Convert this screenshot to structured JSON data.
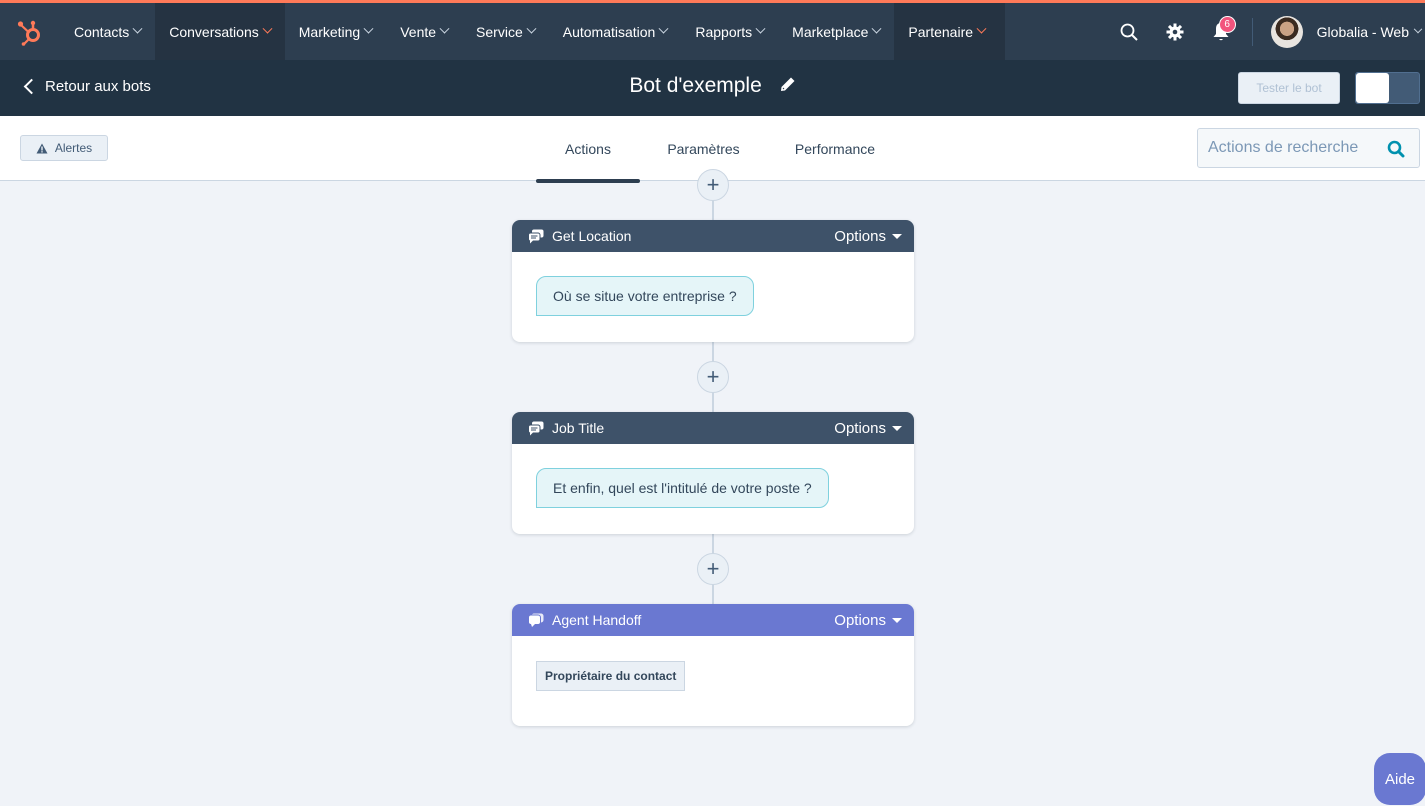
{
  "topnav": {
    "logo": "hubspot-sprocket-icon",
    "items": [
      {
        "label": "Contacts",
        "active": false
      },
      {
        "label": "Conversations",
        "active": true
      },
      {
        "label": "Marketing",
        "active": false
      },
      {
        "label": "Vente",
        "active": false
      },
      {
        "label": "Service",
        "active": false
      },
      {
        "label": "Automatisation",
        "active": false
      },
      {
        "label": "Rapports",
        "active": false
      },
      {
        "label": "Marketplace",
        "active": false
      },
      {
        "label": "Partenaire",
        "active": true
      }
    ],
    "notifications_count": "6",
    "account_name": "Globalia - Web",
    "icons": [
      "search-icon",
      "gear-icon",
      "bell-icon"
    ]
  },
  "subheader": {
    "back_label": "Retour aux bots",
    "title": "Bot d'exemple",
    "test_button": "Tester le bot",
    "toggle_on": false
  },
  "tabbar": {
    "alerts_label": "Alertes",
    "tabs": [
      {
        "label": "Actions",
        "active": true
      },
      {
        "label": "Paramètres",
        "active": false
      },
      {
        "label": "Performance",
        "active": false
      }
    ],
    "search_placeholder": "Actions de recherche"
  },
  "actions": [
    {
      "title": "Get Location",
      "type": "question",
      "options_label": "Options",
      "message": "Où se situe votre entreprise ?"
    },
    {
      "title": "Job Title",
      "type": "question",
      "options_label": "Options",
      "message": "Et enfin, quel est l'intitulé de votre poste ?"
    },
    {
      "title": "Agent Handoff",
      "type": "handoff",
      "options_label": "Options",
      "tag": "Propriétaire du contact"
    }
  ],
  "colors": {
    "brand": "#ff7a59",
    "nav_bg": "#2d3e50",
    "question_header": "#3e5269",
    "handoff_header": "#6a78d1",
    "badge": "#f2547d"
  },
  "help_label": "Aide"
}
